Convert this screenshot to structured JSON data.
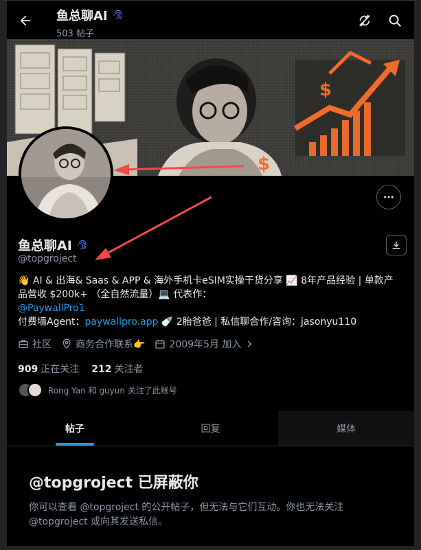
{
  "header": {
    "back_icon": "arrow-left-icon",
    "title": "鱼总聊AI",
    "post_count": "503 帖子",
    "icons": [
      "sync-slash-icon",
      "search-icon"
    ]
  },
  "profile": {
    "name": "鱼总聊AI",
    "handle": "@topgroject",
    "bio_line1": "👋 AI & 出海& Saas & APP & 海外手机卡eSIM实操干货分享 📈 8年产品经验 | 单款产",
    "bio_line2": "品营收 $200k+ （全自然流量）💻 代表作：",
    "bio_link1": "@PaywallPro1",
    "bio_line4_prefix": " 付费墙Agent：",
    "bio_link2": "paywallpro.app",
    "bio_line4_suffix": " 🍼 2胎爸爸 | 私信聊合作/咨询：jasonyu110",
    "meta_community": "社区",
    "meta_location": "商务合作联系👉",
    "meta_joined": "2009年5月 加入",
    "following_count": "909",
    "following_label": "正在关注",
    "followers_count": "212",
    "followers_label": "关注者",
    "followed_by": "Rong Yan 和 guyun 关注了此账号"
  },
  "tabs": [
    {
      "label": "帖子"
    },
    {
      "label": "回复"
    },
    {
      "label": "媒体"
    }
  ],
  "blocked": {
    "title": "@topgroject 已屏蔽你",
    "desc": "你可以查看 @topgroject 的公开帖子，但无法与它们互动。你也无法关注 @topgroject 或向其发送私信。"
  },
  "colors": {
    "accent": "#1d9bf0",
    "annotation_arrow": "#f04a4a",
    "verified": "#4a6cf7"
  }
}
